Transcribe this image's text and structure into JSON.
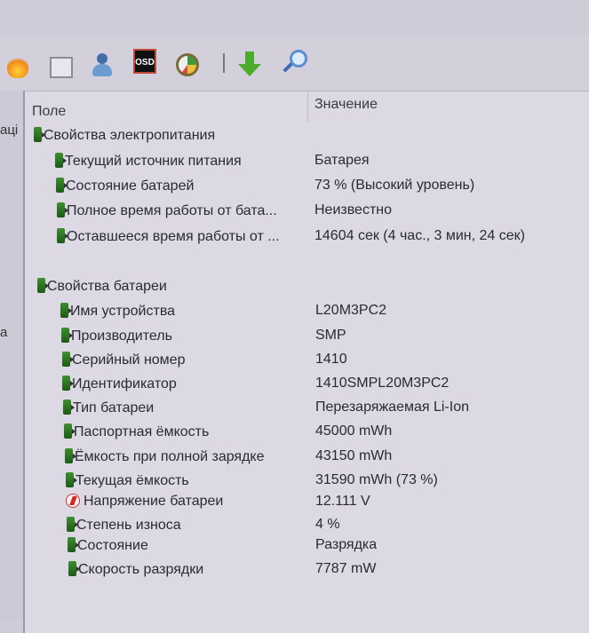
{
  "toolbar": {
    "icons": [
      "fire-icon",
      "scheduler-icon",
      "user-icon",
      "osd-icon",
      "gauge-icon",
      "download-arrow-icon",
      "search-icon"
    ],
    "osd_label": "OSD"
  },
  "left_pane": {
    "fragments": [
      "аці",
      "а"
    ]
  },
  "table": {
    "headers": {
      "field": "Поле",
      "value": "Значение"
    },
    "groups": [
      {
        "title": "Свойства электропитания",
        "rows": [
          {
            "field": "Текущий источник питания",
            "value": "Батарея"
          },
          {
            "field": "Состояние батарей",
            "value": "73 % (Высокий уровень)"
          },
          {
            "field": "Полное время работы от бата...",
            "value": "Неизвестно"
          },
          {
            "field": "Оставшееся время работы от ...",
            "value": "14604 сек (4 час., 3 мин, 24 сек)"
          }
        ]
      },
      {
        "title": "Свойства батареи",
        "rows": [
          {
            "field": "Имя устройства",
            "value": "L20M3PC2"
          },
          {
            "field": "Производитель",
            "value": "SMP"
          },
          {
            "field": "Серийный номер",
            "value": "1410"
          },
          {
            "field": "Идентификатор",
            "value": "1410SMPL20M3PC2"
          },
          {
            "field": "Тип батареи",
            "value": "Перезаряжаемая Li-Ion"
          },
          {
            "field": "Паспортная ёмкость",
            "value": "45000 mWh"
          },
          {
            "field": "Ёмкость при полной зарядке",
            "value": "43150 mWh"
          },
          {
            "field": "Текущая ёмкость",
            "value": "31590 mWh  (73 %)"
          },
          {
            "field": "Напряжение батареи",
            "value": "12.111 V",
            "icon": "voltage-icon"
          },
          {
            "field": "Степень износа",
            "value": "4 %"
          },
          {
            "field": "Состояние",
            "value": "Разрядка"
          },
          {
            "field": "Скорость разрядки",
            "value": "7787 mW"
          }
        ]
      }
    ]
  }
}
